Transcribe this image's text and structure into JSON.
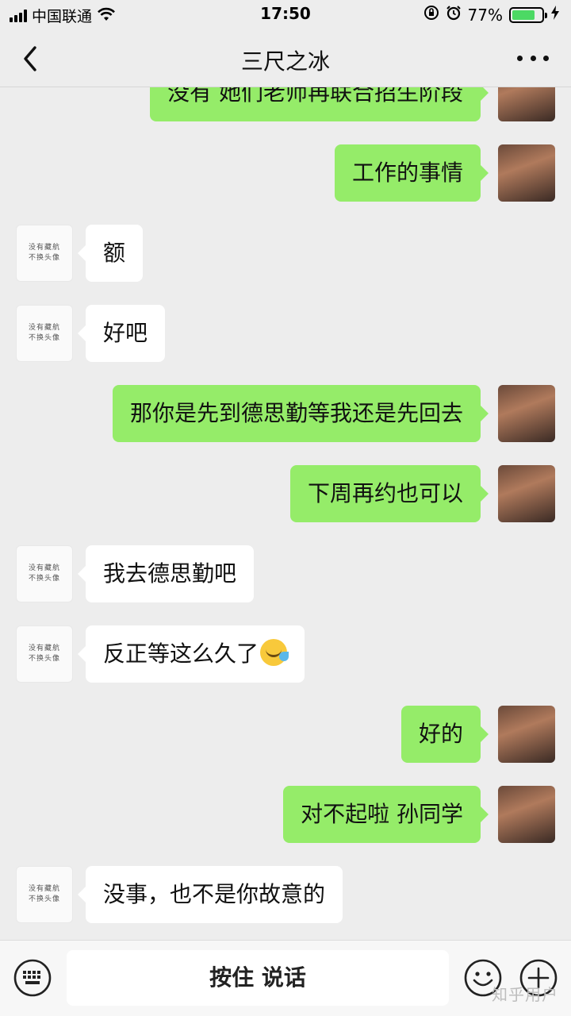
{
  "status_bar": {
    "carrier": "中国联通",
    "time": "17:50",
    "battery": "77%",
    "battery_level": 0.77
  },
  "header": {
    "title": "三尺之冰"
  },
  "messages": [
    {
      "direction": "out",
      "text": "没有 她们老师再联合招生阶段"
    },
    {
      "direction": "out",
      "text": "工作的事情"
    },
    {
      "direction": "in",
      "text": "额"
    },
    {
      "direction": "in",
      "text": "好吧"
    },
    {
      "direction": "out",
      "text": "那你是先到德思勤等我还是先回去"
    },
    {
      "direction": "out",
      "text": "下周再约也可以"
    },
    {
      "direction": "in",
      "text": "我去德思勤吧"
    },
    {
      "direction": "in",
      "text": "反正等这么久了",
      "emoji": "crying-laughing-emoji"
    },
    {
      "direction": "out",
      "text": "好的"
    },
    {
      "direction": "out",
      "text": "对不起啦 孙同学"
    },
    {
      "direction": "in",
      "text": "没事，也不是你故意的"
    }
  ],
  "contact_avatar": {
    "line1": "没有藏航",
    "line2": "不换头像"
  },
  "input_bar": {
    "voice_label": "按住 说话"
  },
  "watermark": "知乎用户",
  "colors": {
    "background": "#ededed",
    "outgoing_bubble": "#95ec69",
    "incoming_bubble": "#ffffff"
  }
}
